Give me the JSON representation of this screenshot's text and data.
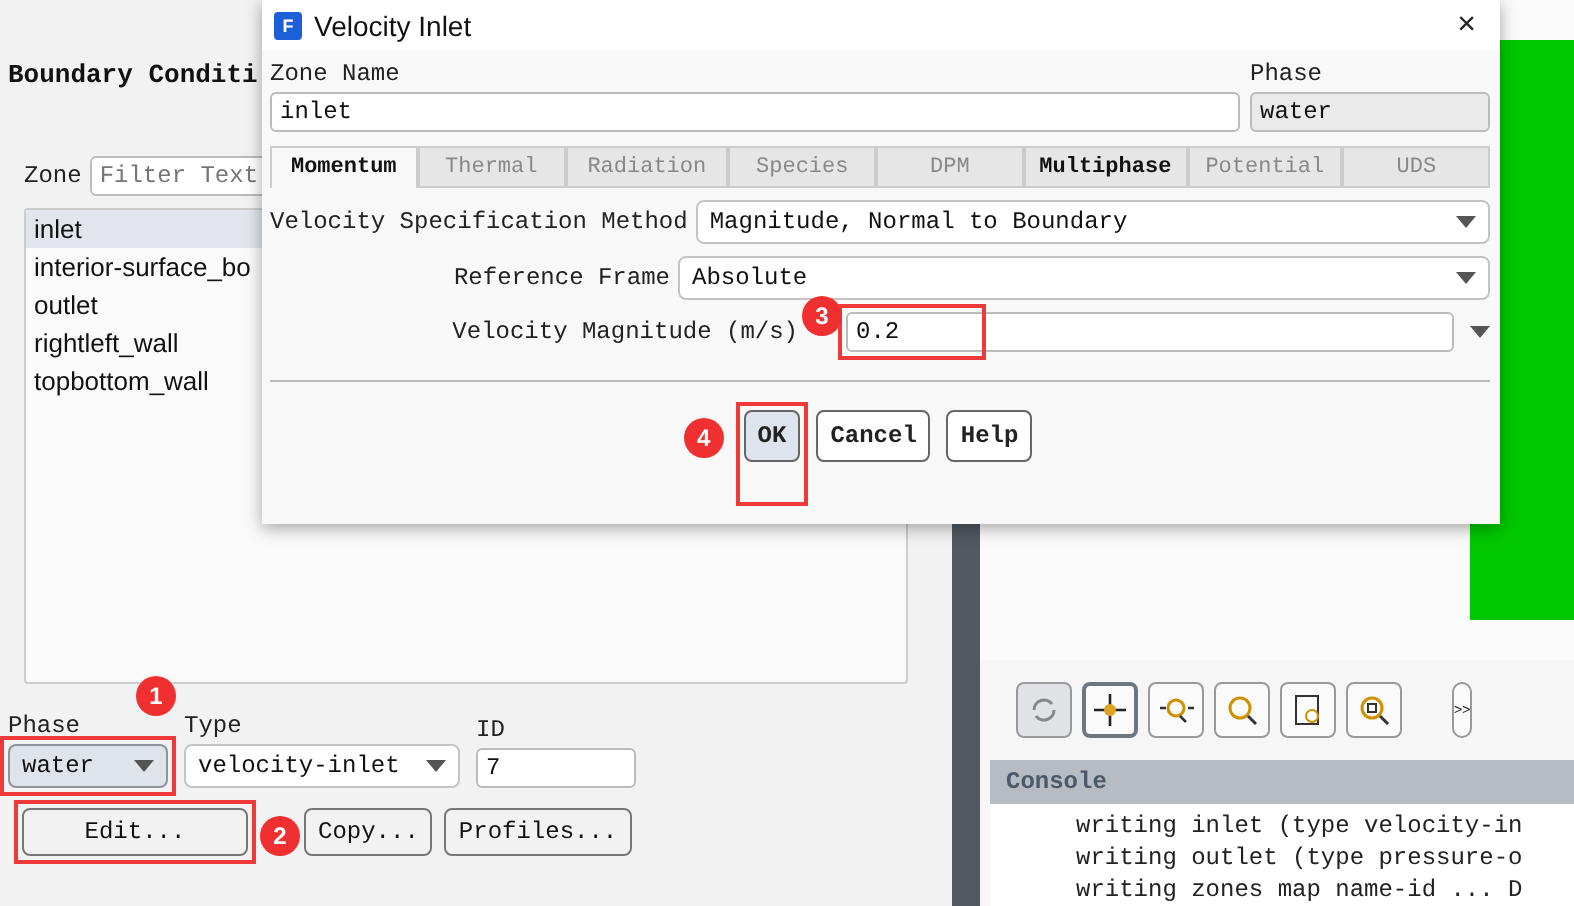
{
  "task_page": {
    "heading": "Boundary Conditi",
    "zone_label": "Zone",
    "filter": {
      "placeholder": "Filter Text"
    },
    "zones": [
      {
        "label": "inlet",
        "selected": true
      },
      {
        "label": "interior-surface_bo",
        "selected": false
      },
      {
        "label": "outlet",
        "selected": false
      },
      {
        "label": "rightleft_wall",
        "selected": false
      },
      {
        "label": "topbottom_wall",
        "selected": false
      }
    ],
    "phase": {
      "label": "Phase",
      "value": "water"
    },
    "type": {
      "label": "Type",
      "value": "velocity-inlet"
    },
    "id": {
      "label": "ID",
      "value": "7"
    },
    "buttons": [
      "Edit...",
      "Copy...",
      "Profiles..."
    ]
  },
  "graphics": {
    "toolbar": [
      {
        "kind": "rotate",
        "disabled": true,
        "selected": false
      },
      {
        "kind": "pan",
        "disabled": false,
        "selected": true
      },
      {
        "kind": "zoom-in-out",
        "disabled": false,
        "selected": false
      },
      {
        "kind": "zoom",
        "disabled": false,
        "selected": false
      },
      {
        "kind": "probe",
        "disabled": false,
        "selected": false
      },
      {
        "kind": "fit",
        "disabled": false,
        "selected": false
      }
    ],
    "overflow": ">>"
  },
  "console": {
    "title": "Console",
    "lines": [
      "writing inlet (type velocity-in",
      "writing outlet (type pressure-o",
      "writing zones map name-id ... D"
    ]
  },
  "dialog": {
    "app_icon": "F",
    "title": "Velocity Inlet",
    "close": "×",
    "zone_name": {
      "label": "Zone Name",
      "value": "inlet"
    },
    "phase": {
      "label": "Phase",
      "value": "water"
    },
    "tabs": [
      {
        "label": "Momentum",
        "selected": true,
        "disabled": false
      },
      {
        "label": "Thermal",
        "selected": false,
        "disabled": true
      },
      {
        "label": "Radiation",
        "selected": false,
        "disabled": true
      },
      {
        "label": "Species",
        "selected": false,
        "disabled": true
      },
      {
        "label": "DPM",
        "selected": false,
        "disabled": true
      },
      {
        "label": "Multiphase",
        "selected": false,
        "disabled": false
      },
      {
        "label": "Potential",
        "selected": false,
        "disabled": true
      },
      {
        "label": "UDS",
        "selected": false,
        "disabled": true
      }
    ],
    "rows": [
      {
        "kind": "dropdown",
        "label": "Velocity Specification Method",
        "value": "Magnitude, Normal to Boundary"
      },
      {
        "kind": "dropdown",
        "label": "Reference Frame",
        "value": "Absolute"
      },
      {
        "kind": "number",
        "label": "Velocity Magnitude (m/s)",
        "value": "0.2"
      }
    ],
    "buttons": [
      {
        "label": "OK",
        "default": true
      },
      {
        "label": "Cancel",
        "default": false
      },
      {
        "label": "Help",
        "default": false
      }
    ]
  },
  "annotations": [
    "1",
    "2",
    "3",
    "4"
  ]
}
